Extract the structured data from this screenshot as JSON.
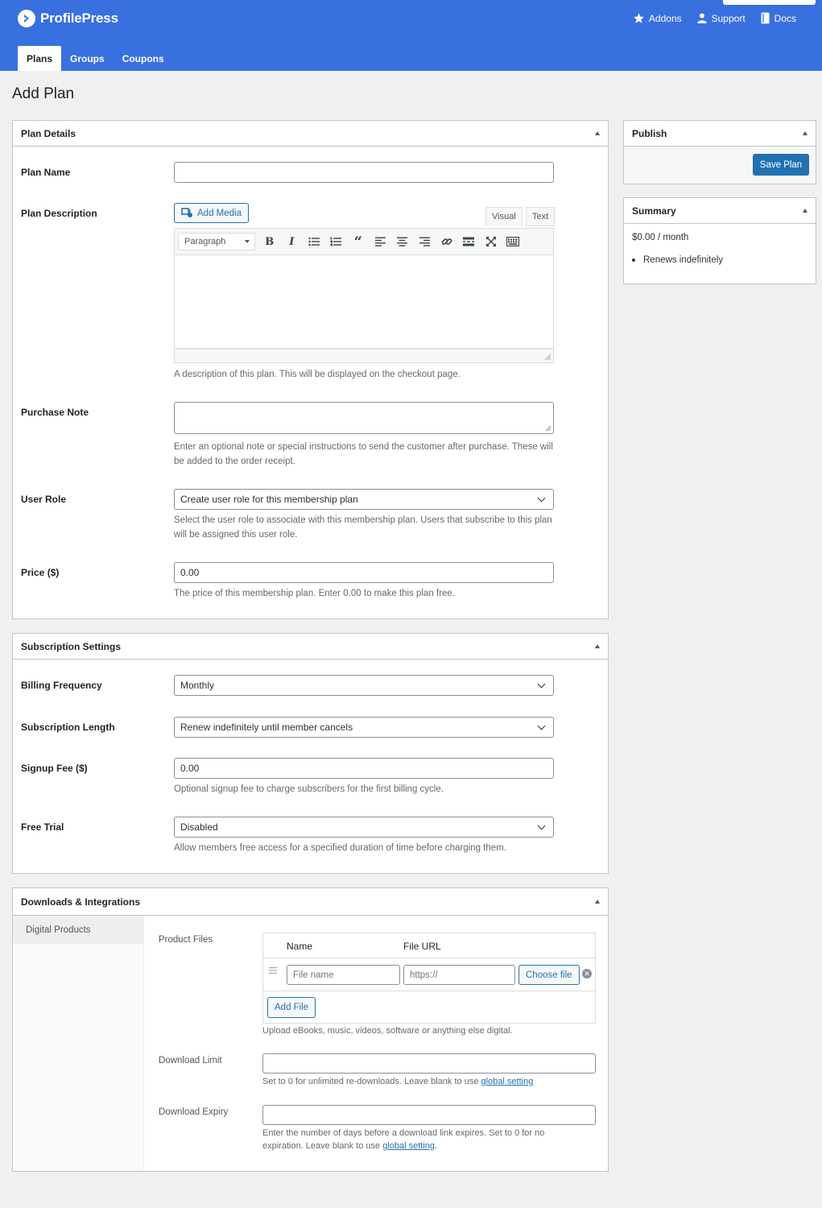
{
  "brand": {
    "name": "ProfilePress"
  },
  "header_links": [
    {
      "label": "Addons",
      "icon": "star-icon"
    },
    {
      "label": "Support",
      "icon": "user-icon"
    },
    {
      "label": "Docs",
      "icon": "book-icon"
    }
  ],
  "tabs": [
    {
      "label": "Plans",
      "active": true
    },
    {
      "label": "Groups",
      "active": false
    },
    {
      "label": "Coupons",
      "active": false
    }
  ],
  "page": {
    "title": "Add Plan"
  },
  "plan_details": {
    "title": "Plan Details",
    "plan_name": {
      "label": "Plan Name",
      "value": ""
    },
    "plan_description": {
      "label": "Plan Description",
      "add_media": "Add Media",
      "tab_visual": "Visual",
      "tab_text": "Text",
      "format": "Paragraph",
      "help": "A description of this plan. This will be displayed on the checkout page."
    },
    "purchase_note": {
      "label": "Purchase Note",
      "value": "",
      "help_line1": "Enter an optional note or special instructions to send the customer after purchase. These will",
      "help_line2": "be added to the order receipt."
    },
    "user_role": {
      "label": "User Role",
      "value": "Create user role for this membership plan",
      "help_line1": "Select the user role to associate with this membership plan. Users that subscribe to this plan",
      "help_line2": "will be assigned this user role."
    },
    "price": {
      "label": "Price ($)",
      "value": "0.00",
      "help": "The price of this membership plan. Enter 0.00 to make this plan free."
    }
  },
  "subscription": {
    "title": "Subscription Settings",
    "billing_frequency": {
      "label": "Billing Frequency",
      "value": "Monthly"
    },
    "subscription_length": {
      "label": "Subscription Length",
      "value": "Renew indefinitely until member cancels"
    },
    "signup_fee": {
      "label": "Signup Fee ($)",
      "value": "0.00",
      "help": "Optional signup fee to charge subscribers for the first billing cycle."
    },
    "free_trial": {
      "label": "Free Trial",
      "value": "Disabled",
      "help": "Allow members free access for a specified duration of time before charging them."
    }
  },
  "downloads": {
    "title": "Downloads & Integrations",
    "side_tab": "Digital Products",
    "product_files": {
      "label": "Product Files",
      "col_name": "Name",
      "col_url": "File URL",
      "name_placeholder": "File name",
      "url_placeholder": "https://",
      "choose_file": "Choose file",
      "add_file": "Add File",
      "help": "Upload eBooks, music, videos, software or anything else digital."
    },
    "download_limit": {
      "label": "Download Limit",
      "help_prefix": "Set to 0 for unlimited re-downloads. Leave blank to use ",
      "help_link": "global setting"
    },
    "download_expiry": {
      "label": "Download Expiry",
      "help_line1": "Enter the number of days before a download link expires. Set to 0 for no",
      "help_prefix2": "expiration. Leave blank to use ",
      "help_link": "global setting",
      "help_suffix": "."
    }
  },
  "publish": {
    "title": "Publish",
    "save_button": "Save Plan"
  },
  "summary": {
    "title": "Summary",
    "price": "$0.00 / month",
    "items": [
      "Renews indefinitely"
    ]
  },
  "colors": {
    "header_bg": "#3870e0",
    "primary": "#2271b1"
  }
}
